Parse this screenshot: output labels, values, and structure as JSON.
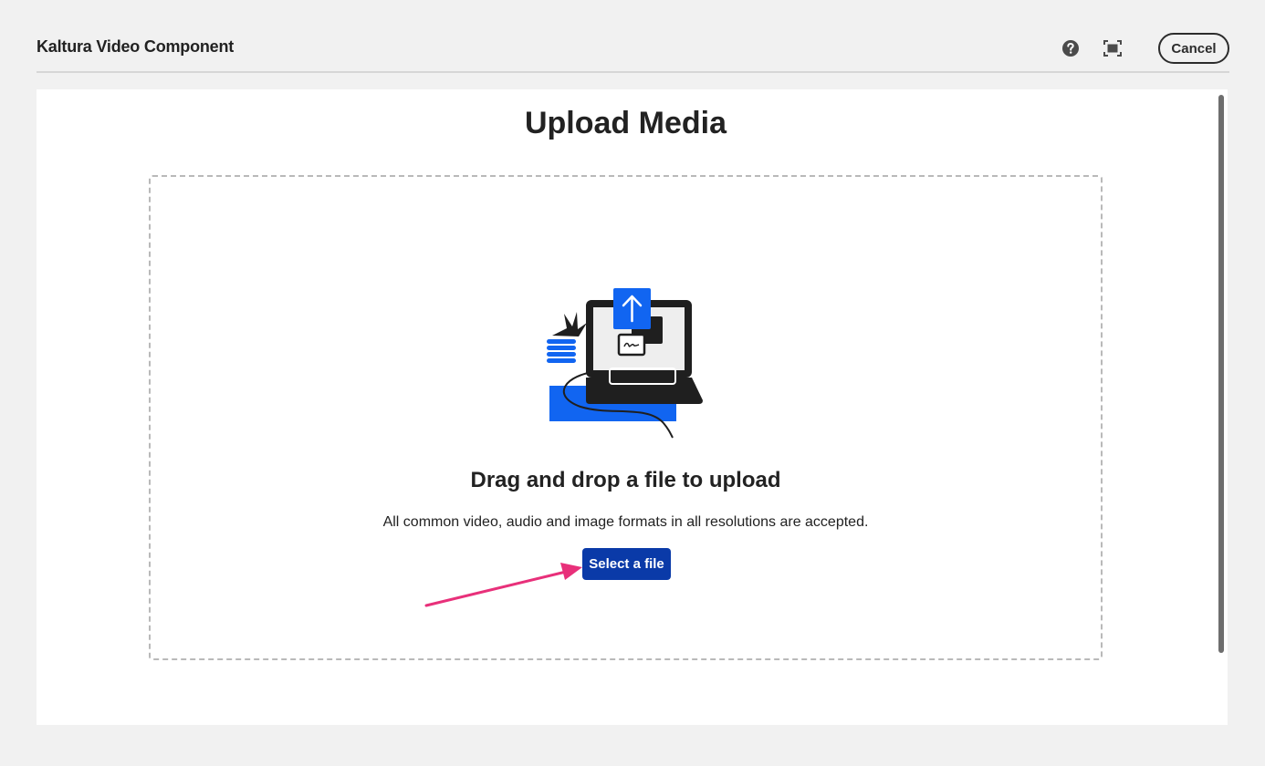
{
  "header": {
    "title": "Kaltura Video Component",
    "cancel_label": "Cancel"
  },
  "icons": {
    "help": "help-icon",
    "fullscreen": "fullscreen-icon",
    "illustration": "laptop-upload-illustration",
    "annotation": "pointer-arrow"
  },
  "main": {
    "title": "Upload Media",
    "drop_heading": "Drag and drop a file to upload",
    "drop_description": "All common video, audio and image formats in all resolutions are accepted.",
    "select_button_label": "Select a file"
  },
  "colors": {
    "primary_button": "#0a3aa8",
    "illustration_blue": "#1165f1",
    "annotation_arrow": "#e8307a"
  }
}
